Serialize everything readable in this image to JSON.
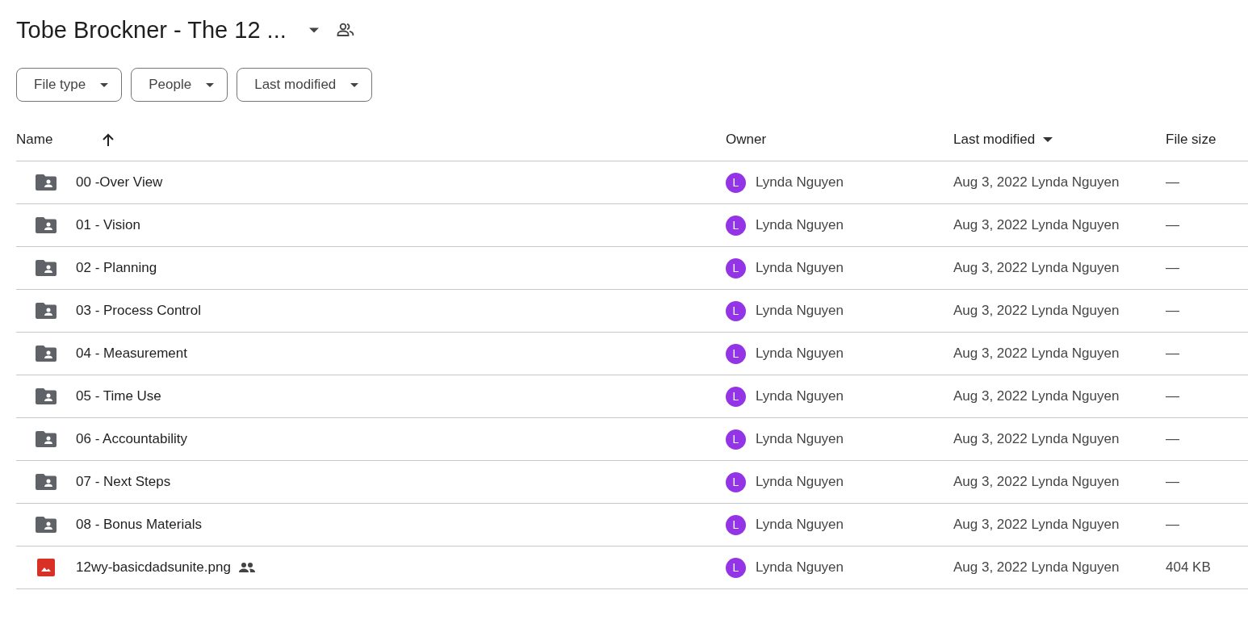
{
  "title": "Tobe Brockner - The 12 ...",
  "filters": [
    "File type",
    "People",
    "Last modified"
  ],
  "columns": [
    {
      "label": "Name",
      "kind": "sorted-up"
    },
    {
      "label": "Owner",
      "kind": "plain"
    },
    {
      "label": "Last modified",
      "kind": "sorted-down"
    },
    {
      "label": "File size",
      "kind": "plain"
    }
  ],
  "rows": [
    {
      "kind": "folder",
      "name": "00 -Over View",
      "shared": false,
      "avatar_letter": "L",
      "owner": "Lynda Nguyen",
      "modified": "Aug 3, 2022 Lynda Nguyen",
      "size": "—"
    },
    {
      "kind": "folder",
      "name": "01 - Vision",
      "shared": false,
      "avatar_letter": "L",
      "owner": "Lynda Nguyen",
      "modified": "Aug 3, 2022 Lynda Nguyen",
      "size": "—"
    },
    {
      "kind": "folder",
      "name": "02 - Planning",
      "shared": false,
      "avatar_letter": "L",
      "owner": "Lynda Nguyen",
      "modified": "Aug 3, 2022 Lynda Nguyen",
      "size": "—"
    },
    {
      "kind": "folder",
      "name": "03 - Process Control",
      "shared": false,
      "avatar_letter": "L",
      "owner": "Lynda Nguyen",
      "modified": "Aug 3, 2022 Lynda Nguyen",
      "size": "—"
    },
    {
      "kind": "folder",
      "name": "04 - Measurement",
      "shared": false,
      "avatar_letter": "L",
      "owner": "Lynda Nguyen",
      "modified": "Aug 3, 2022 Lynda Nguyen",
      "size": "—"
    },
    {
      "kind": "folder",
      "name": "05 - Time Use",
      "shared": false,
      "avatar_letter": "L",
      "owner": "Lynda Nguyen",
      "modified": "Aug 3, 2022 Lynda Nguyen",
      "size": "—"
    },
    {
      "kind": "folder",
      "name": "06 - Accountability",
      "shared": false,
      "avatar_letter": "L",
      "owner": "Lynda Nguyen",
      "modified": "Aug 3, 2022 Lynda Nguyen",
      "size": "—"
    },
    {
      "kind": "folder",
      "name": "07 - Next Steps",
      "shared": false,
      "avatar_letter": "L",
      "owner": "Lynda Nguyen",
      "modified": "Aug 3, 2022 Lynda Nguyen",
      "size": "—"
    },
    {
      "kind": "folder",
      "name": "08 - Bonus Materials",
      "shared": false,
      "avatar_letter": "L",
      "owner": "Lynda Nguyen",
      "modified": "Aug 3, 2022 Lynda Nguyen",
      "size": "—"
    },
    {
      "kind": "image",
      "name": "12wy-basicdadsunite.png",
      "shared": true,
      "avatar_letter": "L",
      "owner": "Lynda Nguyen",
      "modified": "Aug 3, 2022 Lynda Nguyen",
      "size": "404 KB"
    }
  ]
}
